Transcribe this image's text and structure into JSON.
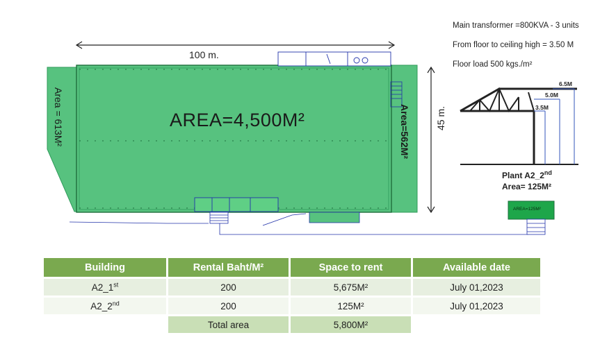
{
  "plan": {
    "width_label": "100 m.",
    "height_label": "45 m.",
    "main_area": "AREA=4,500M²",
    "left_area": "Area = 613M²",
    "right_area": "Area=562M²"
  },
  "specs": [
    "Main transformer =800KVA - 3 units",
    "From floor to ceiling high = 3.50 M",
    "Floor load 500 kgs./m²"
  ],
  "truss": {
    "heights": [
      "6.5M",
      "5.0M",
      "3.5M"
    ]
  },
  "plant2": {
    "title_prefix": "Plant A2_2",
    "title_sup": "nd",
    "area": "Area= 125M²",
    "box_label": "AREA=125M²"
  },
  "table": {
    "headers": [
      "Building",
      "Rental Baht/M²",
      "Space to rent",
      "Available date"
    ],
    "rows": [
      {
        "building": "A2_1",
        "sup": "st",
        "rental": "200",
        "space": "5,675M²",
        "date": "July 01,2023"
      },
      {
        "building": "A2_2",
        "sup": "nd",
        "rental": "200",
        "space": "125M²",
        "date": "July 01,2023"
      }
    ],
    "total_label": "Total area",
    "total_value": "5,800M²"
  },
  "colors": {
    "building_fill": "#57c27f",
    "building_dark": "#2f9a5a",
    "header_green": "#7aa94f"
  }
}
